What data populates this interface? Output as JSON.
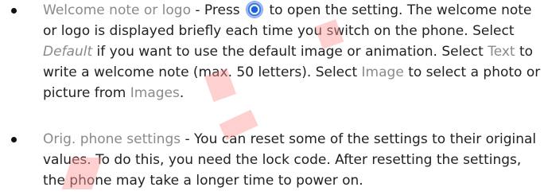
{
  "items": [
    {
      "bullet": "•",
      "term": "Welcome note or logo",
      "dash": " - Press ",
      "icon": "scroll-key-icon",
      "after_icon": " to open the setting. The welcome note or logo is displayed briefly each time you switch on the phone. Select ",
      "option_default": "Default",
      "after_default": " if you want to use the default image or animation. Select ",
      "option_text": "Text",
      "after_text": " to write a welcome note (max. 50 letters). Select ",
      "option_image": "Image",
      "after_image": " to select a photo or picture from ",
      "option_images": "Images",
      "end": "."
    },
    {
      "bullet": "•",
      "term": "Orig. phone settings",
      "rest": " - You can reset some of the settings to their original values. To do this, you need the lock code. After resetting the settings, the phone may take a longer time to power on."
    }
  ],
  "watermark": {
    "text": "DRAFT",
    "color": "#ff9696"
  }
}
